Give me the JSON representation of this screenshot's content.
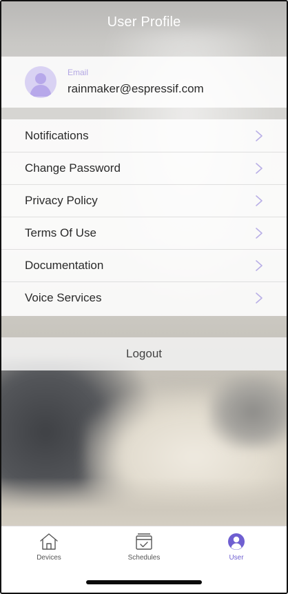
{
  "header": {
    "title": "User Profile"
  },
  "profile": {
    "email_label": "Email",
    "email_value": "rainmaker@espressif.com"
  },
  "menu": {
    "items": [
      {
        "label": "Notifications"
      },
      {
        "label": "Change Password"
      },
      {
        "label": "Privacy Policy"
      },
      {
        "label": "Terms Of Use"
      },
      {
        "label": "Documentation"
      },
      {
        "label": "Voice Services"
      }
    ]
  },
  "logout": {
    "label": "Logout"
  },
  "tabbar": {
    "tabs": [
      {
        "label": "Devices",
        "icon": "home-icon",
        "active": false
      },
      {
        "label": "Schedules",
        "icon": "calendar-check-icon",
        "active": false
      },
      {
        "label": "User",
        "icon": "user-circle-icon",
        "active": true
      }
    ]
  },
  "colors": {
    "accent": "#6f5fd1",
    "avatar_bg": "#d9d2f3",
    "email_label": "#b3a6e3",
    "chevron": "#b8aee6"
  }
}
